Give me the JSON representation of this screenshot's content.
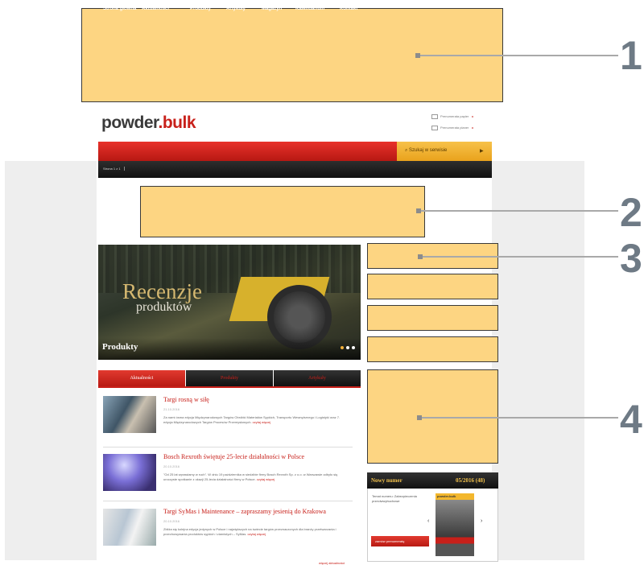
{
  "colors": {
    "placeholder_fill": "#fdd582",
    "brand_red": "#c8201a",
    "search_orange": "#f2b13a",
    "callout_grey": "#6e7a85"
  },
  "callouts": [
    "1",
    "2",
    "3",
    "4"
  ],
  "header": {
    "logo_part1": "powder",
    "logo_dot": ".",
    "logo_part2": "bulk",
    "links": [
      "Prenumerata papier",
      "Prenumerata planer"
    ]
  },
  "nav": {
    "items": [
      "Strona główna",
      "Aktualności",
      "Produkty",
      "Artykuły",
      "Magazyn",
      "Kalendarium",
      "Kontakt"
    ],
    "search_label": "Szukaj w serwisie"
  },
  "subnav": {
    "items": [
      "Strona 1 z 1"
    ]
  },
  "slider": {
    "title_line1": "Recenzje",
    "title_line2": "produktów",
    "caption": "Produkty"
  },
  "tabs": [
    "Aktualności",
    "Produkty",
    "Artykuły"
  ],
  "news": [
    {
      "title": "Targi rosną w siłę",
      "date": "21.10.2016",
      "text": "Za nami ósma edycja Międzynarodowych Targów Obróbki Materiałów Sypkich, Transportu Wewnętrznego i Logistyki oraz 7. edycja Międzynarodowych Targów Procesów Przemysłowych.",
      "more": "czytaj więcej"
    },
    {
      "title": "Bosch Rexroth świętuje 25-lecie działalności w Polsce",
      "date": "20.10.2016",
      "text": "\"Od 25 lat wprawiamy w ruch\". W dniu 19 października w siedzibie firmy Bosch Rexroth Sp. z o.o. w Warszawie odbyło się uroczyste spotkanie z okazji 25-lecia działalności firmy w Polsce.",
      "more": "czytaj więcej"
    },
    {
      "title": "Targi SyMas i Maintenance – zapraszamy jesienią do Krakowa",
      "date": "20.10.2016",
      "text": "Zbliża się kolejna edycja jedynych w Polsce i największych na świecie targów przeznaczonych dla branży przetwarzania i przechowywania produktów sypkich i ziarnistych – SyMas.",
      "more": "czytaj więcej"
    }
  ],
  "news_more": "więcej aktualności",
  "magazine": {
    "label": "Nowy numer",
    "issue": "05/2016 (48)",
    "desc": "Temat numeru: Zabezpieczenia przeciwwybuchowe",
    "cover_title": "powder.bulk",
    "prev_arrow": "‹",
    "next_arrow": "›",
    "button": "zamów prenumeratę"
  }
}
